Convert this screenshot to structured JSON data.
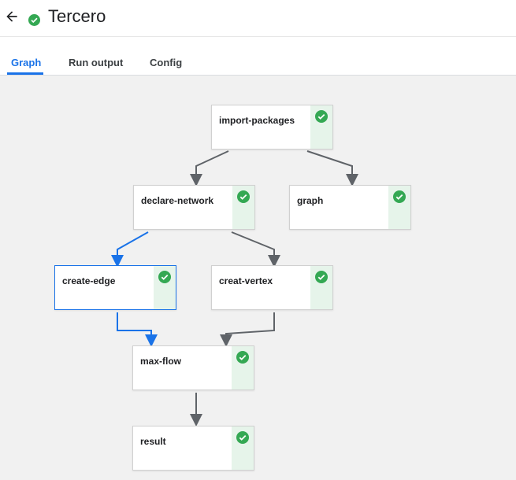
{
  "header": {
    "title": "Tercero",
    "back_icon": "arrow-left-icon",
    "status_icon": "check-circle-icon"
  },
  "tabs": [
    {
      "label": "Graph",
      "active": true
    },
    {
      "label": "Run output",
      "active": false
    },
    {
      "label": "Config",
      "active": false
    }
  ],
  "graph": {
    "nodes": [
      {
        "id": "import-packages",
        "label": "import-packages",
        "status": "succeeded",
        "selected": false
      },
      {
        "id": "declare-network",
        "label": "declare-network",
        "status": "succeeded",
        "selected": false
      },
      {
        "id": "graph",
        "label": "graph",
        "status": "succeeded",
        "selected": false
      },
      {
        "id": "create-edge",
        "label": "create-edge",
        "status": "succeeded",
        "selected": true
      },
      {
        "id": "creat-vertex",
        "label": "creat-vertex",
        "status": "succeeded",
        "selected": false
      },
      {
        "id": "max-flow",
        "label": "max-flow",
        "status": "succeeded",
        "selected": false
      },
      {
        "id": "result",
        "label": "result",
        "status": "succeeded",
        "selected": false
      }
    ],
    "edges": [
      {
        "from": "import-packages",
        "to": "declare-network"
      },
      {
        "from": "import-packages",
        "to": "graph"
      },
      {
        "from": "declare-network",
        "to": "create-edge"
      },
      {
        "from": "declare-network",
        "to": "creat-vertex"
      },
      {
        "from": "create-edge",
        "to": "max-flow"
      },
      {
        "from": "creat-vertex",
        "to": "max-flow"
      },
      {
        "from": "max-flow",
        "to": "result"
      }
    ]
  },
  "colors": {
    "accent": "#1a73e8",
    "success": "#34a853",
    "success_bg": "#e6f4ea",
    "canvas_bg": "#f1f1f1"
  }
}
